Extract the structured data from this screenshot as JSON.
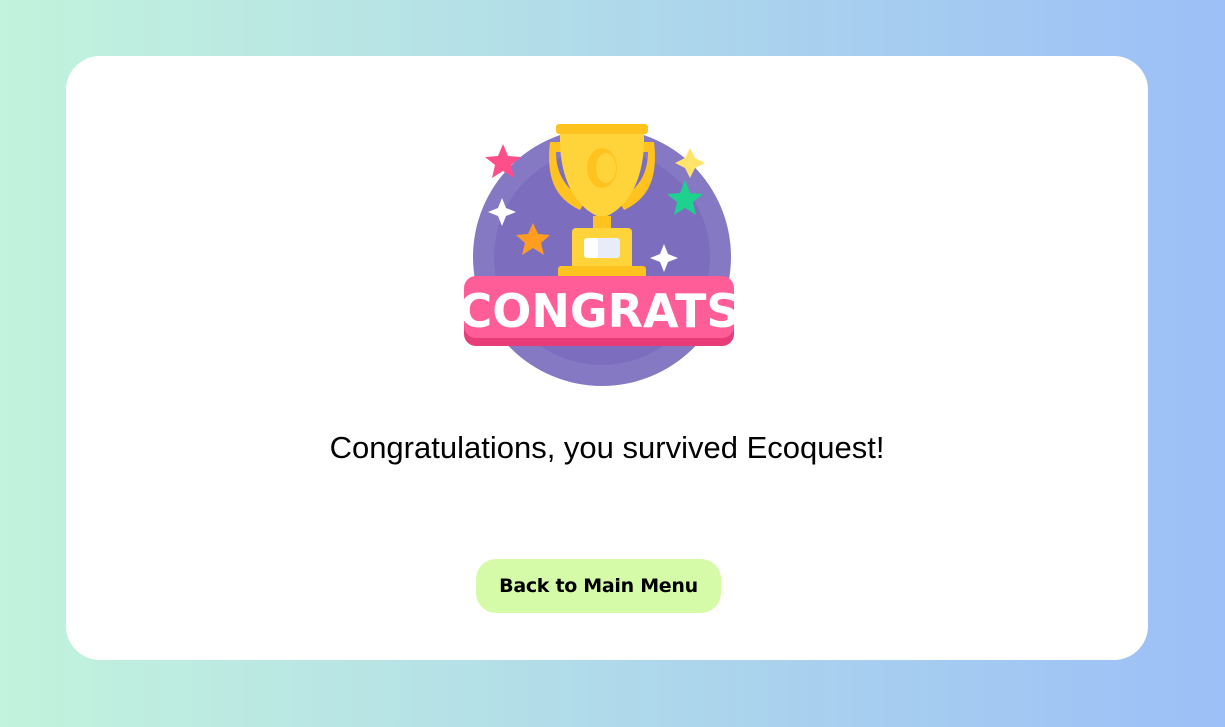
{
  "badge": {
    "icon": "congrats-trophy-icon",
    "text": "CONGRATS",
    "colors": {
      "circle": "#7e6fc0",
      "ribbon": "#ff5d97",
      "trophy": "#ffd43a",
      "star_pink": "#ff4f8a",
      "star_green": "#1fd18e",
      "star_orange": "#ff9d21",
      "star_yellow": "#ffe469"
    }
  },
  "message": "Congratulations, you survived Ecoquest!",
  "button": {
    "label": "Back to Main Menu",
    "color": "#d6fba8"
  }
}
